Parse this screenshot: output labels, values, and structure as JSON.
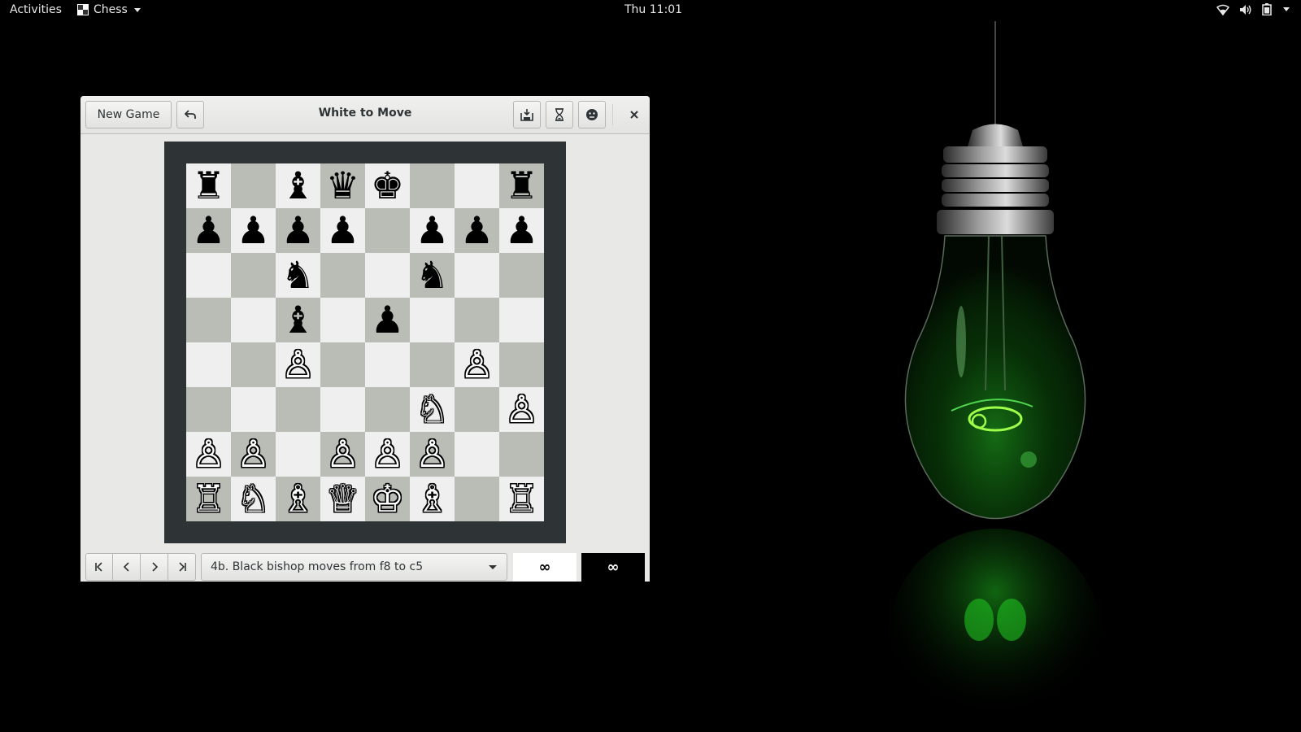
{
  "topbar": {
    "activities": "Activities",
    "app_name": "Chess",
    "clock": "Thu 11:01"
  },
  "window": {
    "title": "White to Move",
    "new_game_label": "New Game",
    "icons": {
      "undo": "undo-icon",
      "save": "save-icon",
      "pause": "hourglass-icon",
      "resign": "emote-icon",
      "close": "close-icon"
    }
  },
  "board": {
    "rows": [
      [
        "♜",
        "",
        "♝",
        "♛",
        "♚",
        "",
        "",
        "♜"
      ],
      [
        "♟",
        "♟",
        "♟",
        "♟",
        "",
        "♟",
        "♟",
        "♟"
      ],
      [
        "",
        "",
        "♞",
        "",
        "",
        "♞",
        "",
        ""
      ],
      [
        "",
        "",
        "♝",
        "",
        "♟",
        "",
        "",
        ""
      ],
      [
        "",
        "",
        "♙",
        "",
        "",
        "",
        "♙",
        ""
      ],
      [
        "",
        "",
        "",
        "",
        "",
        "♘",
        "",
        "♙"
      ],
      [
        "♙",
        "♙",
        "",
        "♙",
        "♙",
        "♙",
        "",
        ""
      ],
      [
        "♖",
        "♘",
        "♗",
        "♕",
        "♔",
        "♗",
        "",
        "♖"
      ]
    ]
  },
  "history": {
    "selected_move": "4b. Black bishop moves from f8 to c5"
  },
  "clocks": {
    "white": "∞",
    "black": "∞"
  },
  "colors": {
    "light_square": "#efefef",
    "dark_square": "#babdb6",
    "board_frame": "#2e3436",
    "wallpaper_glow": "#1ec81e"
  }
}
